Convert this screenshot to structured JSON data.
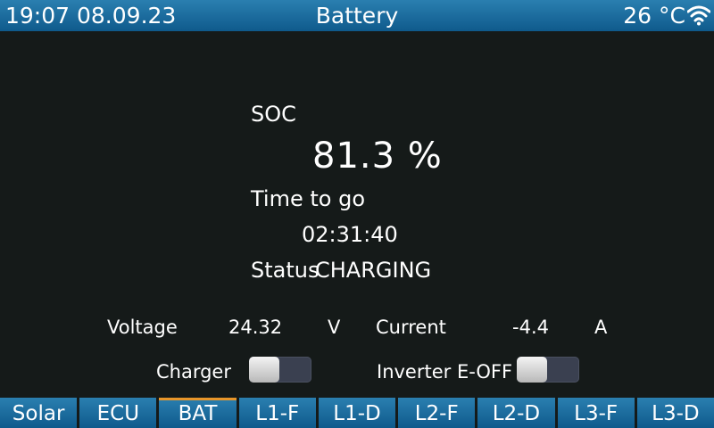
{
  "header": {
    "datetime": "19:07 08.09.23",
    "title": "Battery",
    "temperature": "26 °C",
    "wifi_icon": "wifi-icon"
  },
  "battery": {
    "soc_label": "SOC",
    "soc_value": "81.3 %",
    "time_to_go_label": "Time to go",
    "time_to_go_value": "02:31:40",
    "status_label": "Status",
    "status_value": "CHARGING"
  },
  "measurements": {
    "voltage_label": "Voltage",
    "voltage_value": "24.32",
    "voltage_unit": "V",
    "current_label": "Current",
    "current_value": "-4.4",
    "current_unit": "A"
  },
  "switches": {
    "charger_label": "Charger",
    "charger_on": false,
    "inverter_label": "Inverter E-OFF",
    "inverter_on": false
  },
  "nav": {
    "tabs": [
      "Solar",
      "ECU",
      "BAT",
      "L1-F",
      "L1-D",
      "L2-F",
      "L2-D",
      "L3-F",
      "L3-D"
    ],
    "active_index": 2
  },
  "colors": {
    "accent": "#e8962a",
    "bar": "#1a6a9c",
    "background": "#151a19"
  }
}
